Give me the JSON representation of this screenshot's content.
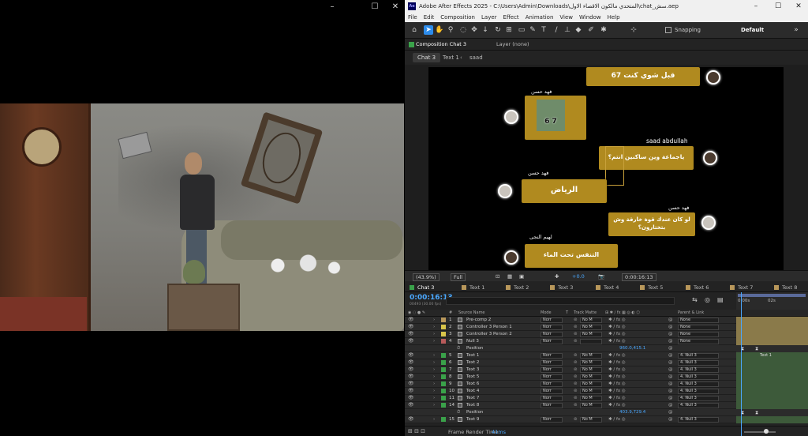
{
  "player": {
    "window_controls": [
      "–",
      "☐",
      "✕"
    ]
  },
  "ae": {
    "title": "Adobe After Effects 2025 - C:\\Users\\Admin\\Downloads\\المتحدي مالكون الاقصاء الاول\\chat_سش.aep",
    "logo": "Ae",
    "window_controls": [
      "–",
      "☐",
      "✕"
    ],
    "menu": [
      "File",
      "Edit",
      "Composition",
      "Layer",
      "Effect",
      "Animation",
      "View",
      "Window",
      "Help"
    ],
    "toolbar": {
      "tools": [
        "home-icon",
        "selection-icon",
        "hand-icon",
        "zoom-icon",
        "orbit-icon",
        "pan-icon",
        "dolly-icon",
        "rotate-icon",
        "pan-behind-icon",
        "rectangle-icon",
        "pen-icon",
        "type-icon",
        "brush-icon",
        "clone-stamp-icon",
        "eraser-icon",
        "roto-brush-icon",
        "puppet-icon"
      ],
      "snapping": "Snapping",
      "workspace": "Default"
    },
    "comp_panel": {
      "tab": "Composition Chat 3",
      "layer_panel": "Layer (none)",
      "breadcrumbs": [
        "Chat 3",
        "Text 1",
        "saad"
      ]
    },
    "canvas": {
      "bubbles": [
        {
          "text": "قبل شوي كنت 67"
        },
        {
          "text": "ياجماعة وين ساكنين انتم؟"
        },
        {
          "text": "الرياض"
        },
        {
          "text": "لو كان عندك قوة خارقة وش بتختارون؟"
        },
        {
          "text": "التنفس تحت الماء"
        }
      ],
      "names": [
        "فهد حسن",
        "saad abdullah",
        "فهد حسن",
        "فهد حسن",
        "لهيم النجى"
      ],
      "photo_caption": "6 7"
    },
    "viewer_bar": {
      "zoom": "(43.9%)",
      "resolution": "Full",
      "exposure": "+0.0",
      "time": "0:00:16:13"
    },
    "timeline": {
      "tabs": [
        "Chat 3",
        "Text 1",
        "Text 2",
        "Text 3",
        "Text 4",
        "Text 5",
        "Text 6",
        "Text 7",
        "Text 8"
      ],
      "timecode": "0:00:16:13",
      "timecode_sub": "00493 (30.00 fps)",
      "ruler": [
        "0:00s",
        "02s"
      ],
      "columns": [
        "Source Name",
        "Mode",
        "T",
        "Track Matte",
        "Parent & Link"
      ],
      "layers": [
        {
          "num": "1",
          "name": "Pre-comp 2",
          "mode": "Norr",
          "matte": "No M",
          "parent": "None",
          "color": "#b8975a"
        },
        {
          "num": "2",
          "name": "Controller 3 Person 1",
          "mode": "Norr",
          "matte": "No M",
          "parent": "None",
          "color": "#d8c44a"
        },
        {
          "num": "3",
          "name": "Controller 3 Person 2",
          "mode": "Norr",
          "matte": "No M",
          "parent": "None",
          "color": "#d8c44a"
        },
        {
          "num": "4",
          "name": "Null 3",
          "mode": "Norr",
          "matte": "",
          "parent": "None",
          "color": "#b85a5a"
        },
        {
          "num": "",
          "name": "Position",
          "value": "960.0,415.1",
          "prop": true
        },
        {
          "num": "5",
          "name": "Text 1",
          "mode": "Norr",
          "matte": "No M",
          "parent": "4. Null 3",
          "color": "#3aa24a"
        },
        {
          "num": "6",
          "name": "Text 2",
          "mode": "Norr",
          "matte": "No M",
          "parent": "4. Null 3",
          "color": "#3aa24a"
        },
        {
          "num": "7",
          "name": "Text 3",
          "mode": "Norr",
          "matte": "No M",
          "parent": "4. Null 3",
          "color": "#3aa24a"
        },
        {
          "num": "8",
          "name": "Text 5",
          "mode": "Norr",
          "matte": "No M",
          "parent": "4. Null 3",
          "color": "#3aa24a"
        },
        {
          "num": "9",
          "name": "Text 6",
          "mode": "Norr",
          "matte": "No M",
          "parent": "4. Null 3",
          "color": "#3aa24a"
        },
        {
          "num": "10",
          "name": "Text 4",
          "mode": "Norr",
          "matte": "No M",
          "parent": "4. Null 3",
          "color": "#3aa24a"
        },
        {
          "num": "11",
          "name": "Text 7",
          "mode": "Norr",
          "matte": "No M",
          "parent": "4. Null 3",
          "color": "#3aa24a"
        },
        {
          "num": "14",
          "name": "Text 8",
          "mode": "Norr",
          "matte": "No M",
          "parent": "4. Null 3",
          "color": "#3aa24a"
        },
        {
          "num": "",
          "name": "Position",
          "value": "403.9,729.4",
          "prop": true
        },
        {
          "num": "15",
          "name": "Text 9",
          "mode": "Norr",
          "matte": "No M",
          "parent": "4. Null 3",
          "color": "#3aa24a"
        }
      ],
      "keyframe_label": "Text 1",
      "render_label": "Frame Render Time:",
      "render_value": "41ms"
    }
  }
}
